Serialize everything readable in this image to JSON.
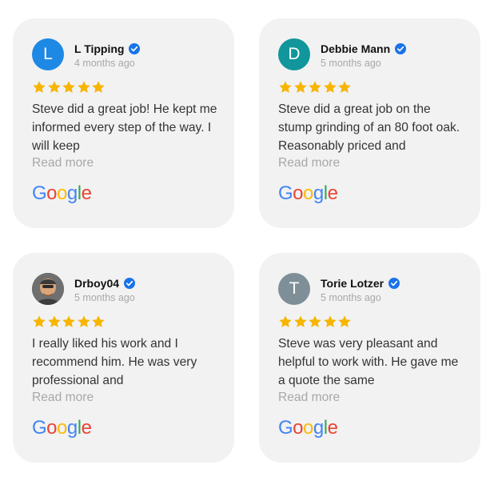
{
  "brand": {
    "google_letters": [
      {
        "ch": "G",
        "color": "#4285F4"
      },
      {
        "ch": "o",
        "color": "#EA4335"
      },
      {
        "ch": "o",
        "color": "#FBBC05"
      },
      {
        "ch": "g",
        "color": "#4285F4"
      },
      {
        "ch": "l",
        "color": "#34A853"
      },
      {
        "ch": "e",
        "color": "#EA4335"
      }
    ],
    "star_color": "#F7B500",
    "verified_color": "#1A73E8"
  },
  "reviews": [
    {
      "name": "L Tipping",
      "date": "4 months ago",
      "initial": "L",
      "avatar_color": "#1E88E5",
      "rating": 5,
      "text": "Steve did a great job! He kept me informed every step of the way. I will keep",
      "read_more": "Read more"
    },
    {
      "name": "Debbie Mann",
      "date": "5 months ago",
      "initial": "D",
      "avatar_color": "#10969B",
      "rating": 5,
      "text": "Steve did a great job on the stump grinding of an 80 foot oak. Reasonably priced and",
      "read_more": "Read more"
    },
    {
      "name": "Drboy04",
      "date": "5 months ago",
      "initial": "",
      "avatar_color": "#4a4a4a",
      "rating": 5,
      "text": "I really liked his work and I recommend him. He was very professional and",
      "read_more": "Read more"
    },
    {
      "name": "Torie Lotzer",
      "date": "5 months ago",
      "initial": "T",
      "avatar_color": "#7E8F97",
      "rating": 5,
      "text": "Steve was very pleasant and helpful to work with. He gave me a quote the same",
      "read_more": "Read more"
    }
  ]
}
